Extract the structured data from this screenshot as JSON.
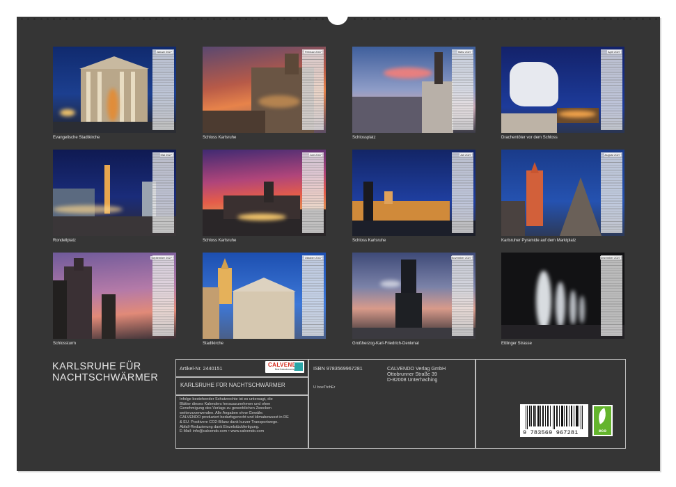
{
  "calendar": {
    "title_line1": "KARLSRUHE FÜR",
    "title_line2": "NACHTSCHWÄRMER",
    "pages": [
      {
        "month": "Januar 2027",
        "caption": "Evangelische Stadtkirche"
      },
      {
        "month": "Februar 2027",
        "caption": "Schloss Karlsruhe"
      },
      {
        "month": "März 2027",
        "caption": "Schlossplatz"
      },
      {
        "month": "April 2027",
        "caption": "Drachentöter vor dem Schloss"
      },
      {
        "month": "Mai 2027",
        "caption": "Rondellplatz"
      },
      {
        "month": "Juni 2027",
        "caption": "Schloss Karlsruhe"
      },
      {
        "month": "Juli 2027",
        "caption": "Schloss Karlsruhe"
      },
      {
        "month": "August 2027",
        "caption": "Karlsruher Pyramide auf dem Marktplatz"
      },
      {
        "month": "September 2027",
        "caption": "Schlossturm"
      },
      {
        "month": "Oktober 2027",
        "caption": "Stadtkirche"
      },
      {
        "month": "November 2027",
        "caption": "Großherzog-Karl-Friedrich-Denkmal"
      },
      {
        "month": "Dezember 2027",
        "caption": "Ettlinger Strasse"
      }
    ]
  },
  "info": {
    "article_no": "Artikel-Nr. 2440151",
    "logo_text": "CALVENDO",
    "logo_sub": "Best Kalenderverlag",
    "product_title": "KARLSRUHE FÜR NACHTSCHWÄRMER",
    "legal_lines": [
      "Infolge bestehender Schutzrechte ist es untersagt, die",
      "Blätter dieses Kalenders herauszunehmen und ohne",
      "Genehmigung des Verlags zu gewerblichen Zwecken",
      "weiterzuverwenden. Alle Angaben ohne Gewähr.",
      "CALVENDO produziert bedarfsgerecht und klimabewusst in DE",
      "& EU. Positivere CO2-Bilanz dank kurzer Transportwege.",
      "Abfall-Reduzierung dank Einzelstückfertigung.",
      "E-Mail: info@calvendo.com • www.calvendo.com"
    ],
    "isbn": "ISBN 9783569967281",
    "author": "U boeTtchEr",
    "publisher": [
      "CALVENDO Verlag GmbH",
      "Ottobrunner Straße 39",
      "D-82008 Unterhaching"
    ],
    "barcode_number": "9 783569 967281",
    "eco_label": "eco"
  },
  "colors": {
    "sheet": "#353535",
    "border": "#bdbdbd",
    "eco_green": "#64b42d",
    "calvendo_red": "#d42a1d",
    "calvendo_teal": "#2aa5a6"
  }
}
